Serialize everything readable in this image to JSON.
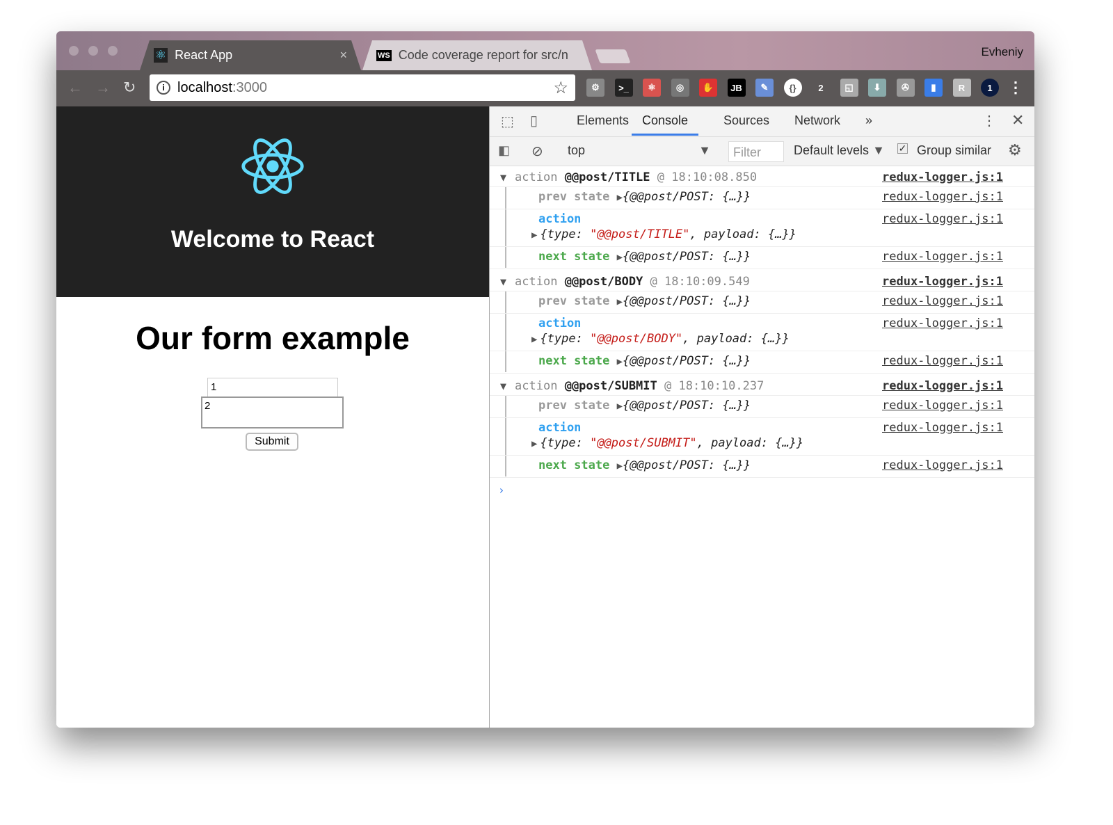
{
  "browser": {
    "tabs": [
      {
        "label": "React App",
        "close": "×"
      },
      {
        "label": "Code coverage report for src/n",
        "close": "×"
      }
    ],
    "user": "Evheniy",
    "address_host": "localhost",
    "address_port": ":3000",
    "extensions": [
      "gear",
      "terminal",
      "react-devtools",
      "target",
      "adblock",
      "jetbrains",
      "eyedropper",
      "json-viewer",
      "applet",
      "cast",
      "download",
      "film",
      "lighthouse",
      "r-extension",
      "1password"
    ]
  },
  "page": {
    "hero_title": "Welcome to React",
    "form_title": "Our form example",
    "input_value": "1",
    "textarea_value": "2",
    "submit_label": "Submit"
  },
  "devtools": {
    "tabs": [
      "Elements",
      "Console",
      "Sources",
      "Network",
      "»"
    ],
    "context": "top",
    "filter_placeholder": "Filter",
    "levels": "Default levels",
    "group_similar": "Group similar",
    "group_similar_checked": true,
    "logs": [
      {
        "label": "action",
        "type": "@@post/TITLE",
        "time": "@ 18:10:08.850",
        "source": "redux-logger.js:1",
        "prev": "prev state",
        "action": "action",
        "next": "next state",
        "state": "{@@post/POST: {…}}",
        "action_obj_pre": "{type: ",
        "action_obj_type": "\"@@post/TITLE\"",
        "action_obj_post": ", payload: {…}}"
      },
      {
        "label": "action",
        "type": "@@post/BODY",
        "time": "@ 18:10:09.549",
        "source": "redux-logger.js:1",
        "prev": "prev state",
        "action": "action",
        "next": "next state",
        "state": "{@@post/POST: {…}}",
        "action_obj_pre": "{type: ",
        "action_obj_type": "\"@@post/BODY\"",
        "action_obj_post": ", payload: {…}}"
      },
      {
        "label": "action",
        "type": "@@post/SUBMIT",
        "time": "@ 18:10:10.237",
        "source": "redux-logger.js:1",
        "prev": "prev state",
        "action": "action",
        "next": "next state",
        "state": "{@@post/POST: {…}}",
        "action_obj_pre": "{type: ",
        "action_obj_type": "\"@@post/SUBMIT\"",
        "action_obj_post": ", payload: {…}}"
      }
    ]
  }
}
